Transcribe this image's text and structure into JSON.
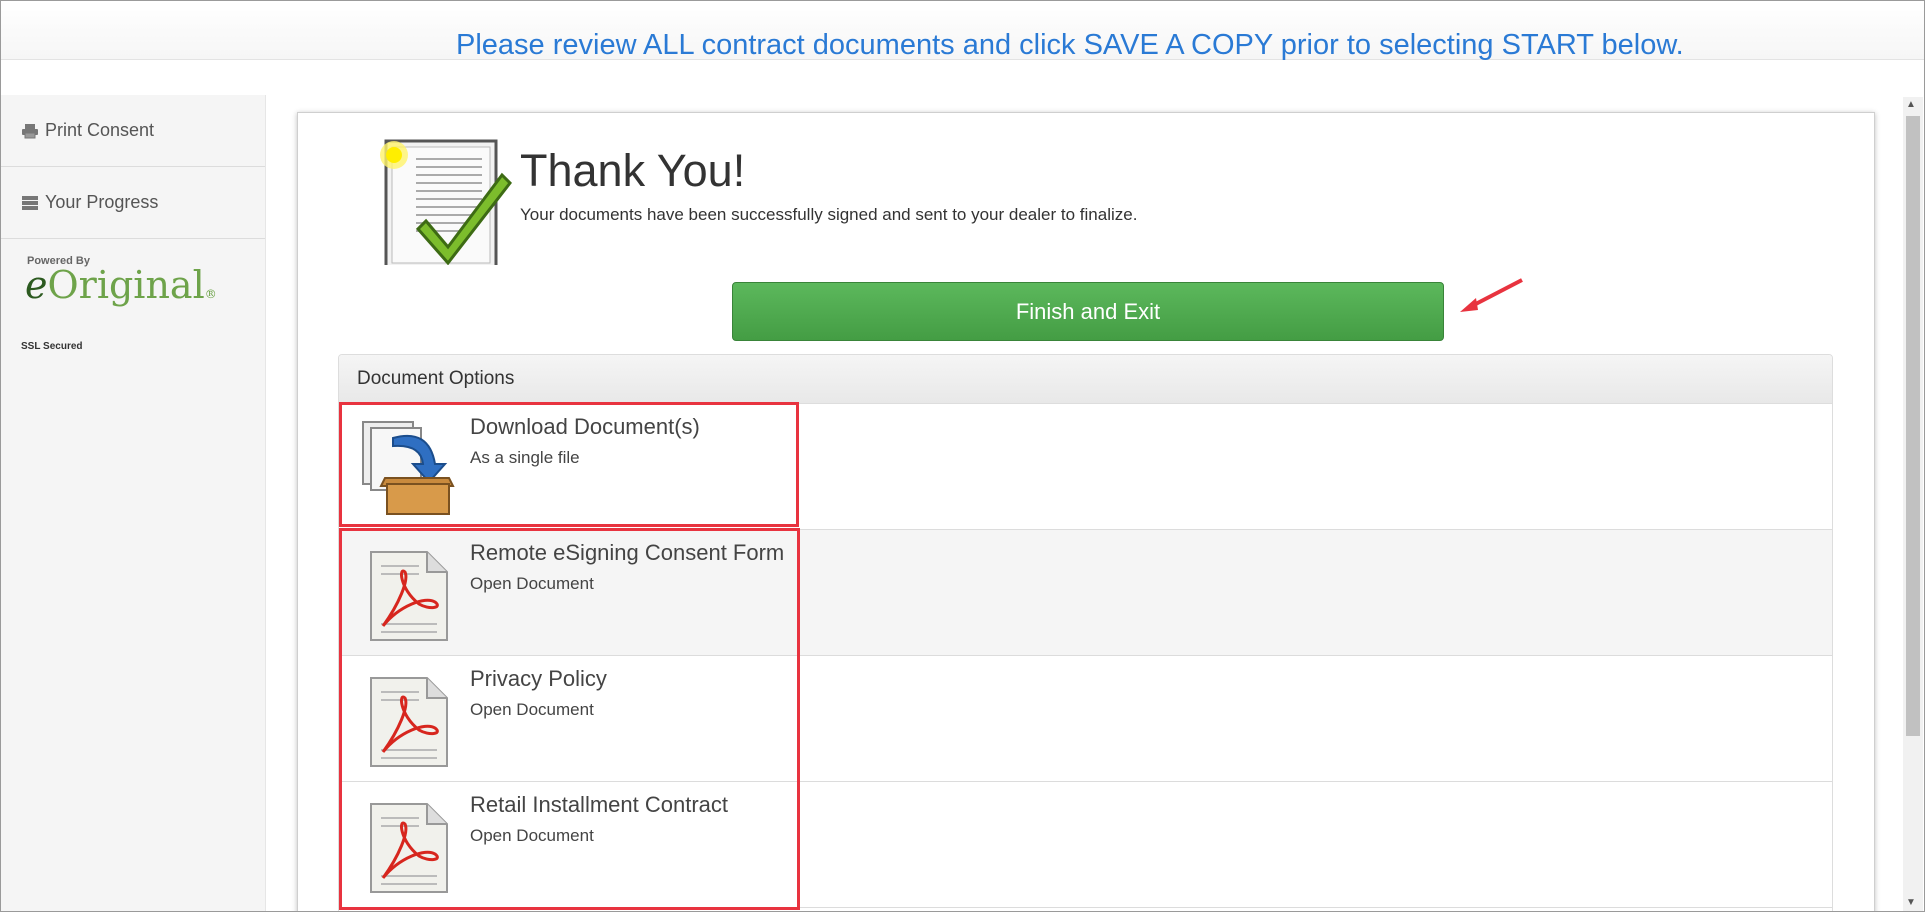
{
  "banner": "Please review ALL contract documents and click SAVE A COPY prior to selecting START below.",
  "sidebar": {
    "items": [
      {
        "label": "Print Consent",
        "icon": "printer-icon"
      },
      {
        "label": "Your Progress",
        "icon": "list-icon"
      }
    ],
    "powered_by": "Powered By",
    "brand_e": "e",
    "brand_rest": "Original",
    "brand_mark": "®",
    "ssl": "SSL Secured"
  },
  "main": {
    "title": "Thank You!",
    "subtitle": "Your documents have been successfully signed and sent to your dealer to finalize.",
    "finish_button": "Finish and Exit",
    "panel_heading": "Document Options",
    "options": [
      {
        "title": "Download Document(s)",
        "sub": "As a single file",
        "icon": "download-box-icon"
      },
      {
        "title": "Remote eSigning Consent Form",
        "sub": "Open Document",
        "icon": "pdf-file-icon"
      },
      {
        "title": "Privacy Policy",
        "sub": "Open Document",
        "icon": "pdf-file-icon"
      },
      {
        "title": "Retail Installment Contract",
        "sub": "Open Document",
        "icon": "pdf-file-icon"
      }
    ]
  },
  "colors": {
    "banner_text": "#2a7ad5",
    "finish_button": "#4cae4c",
    "highlight": "#e8333f"
  }
}
